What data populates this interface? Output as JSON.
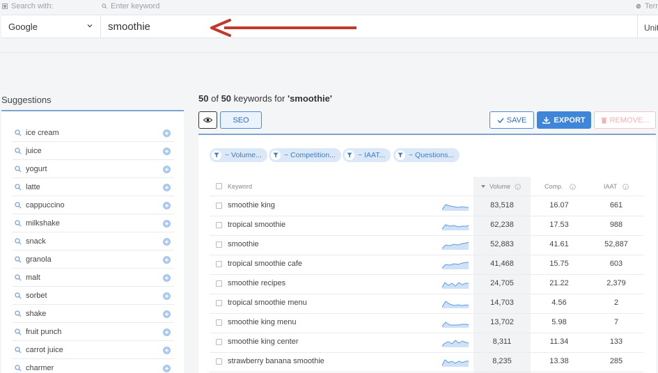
{
  "search": {
    "engine_label": "Search with:",
    "keyword_label": "Enter keyword",
    "territory_label": "Terr",
    "engine_value": "Google",
    "keyword_value": "smoothie",
    "territory_value": "Unit"
  },
  "suggestions": {
    "title": "Suggestions",
    "items": [
      "ice cream",
      "juice",
      "yogurt",
      "latte",
      "cappuccino",
      "milkshake",
      "snack",
      "granola",
      "malt",
      "sorbet",
      "shake",
      "fruit punch",
      "carrot juice",
      "charmer"
    ]
  },
  "results": {
    "count_shown": "50",
    "of_text": "of",
    "count_total": "50",
    "keywords_for_text": "keywords for",
    "query_quoted": "'smoothie'"
  },
  "toolbar": {
    "seo_label": "SEO",
    "save_label": "SAVE",
    "export_label": "EXPORT",
    "remove_label": "REMOVE..."
  },
  "filters": [
    "~ Volume...",
    "~ Competition...",
    "~ IAAT...",
    "~ Questions..."
  ],
  "table": {
    "headers": {
      "keyword": "Keyword",
      "volume": "Volume",
      "comp": "Comp.",
      "iaat": "IAAT"
    },
    "rows": [
      {
        "keyword": "smoothie king",
        "volume": "83,518",
        "comp": "16.07",
        "iaat": "661"
      },
      {
        "keyword": "tropical smoothie",
        "volume": "62,238",
        "comp": "17.53",
        "iaat": "988"
      },
      {
        "keyword": "smoothie",
        "volume": "52,883",
        "comp": "41.61",
        "iaat": "52,887"
      },
      {
        "keyword": "tropical smoothie cafe",
        "volume": "41,468",
        "comp": "15.75",
        "iaat": "603"
      },
      {
        "keyword": "smoothie recipes",
        "volume": "24,705",
        "comp": "21.22",
        "iaat": "2,379"
      },
      {
        "keyword": "tropical smoothie menu",
        "volume": "14,703",
        "comp": "4.56",
        "iaat": "2"
      },
      {
        "keyword": "smoothie king menu",
        "volume": "13,702",
        "comp": "5.98",
        "iaat": "7"
      },
      {
        "keyword": "smoothie king center",
        "volume": "8,311",
        "comp": "11.34",
        "iaat": "133"
      },
      {
        "keyword": "strawberry banana smoothie",
        "volume": "8,235",
        "comp": "13.38",
        "iaat": "285"
      }
    ]
  },
  "colors": {
    "accent": "#3f86d8",
    "arrow": "#c0392b",
    "sparkline": "#5b9be0"
  }
}
